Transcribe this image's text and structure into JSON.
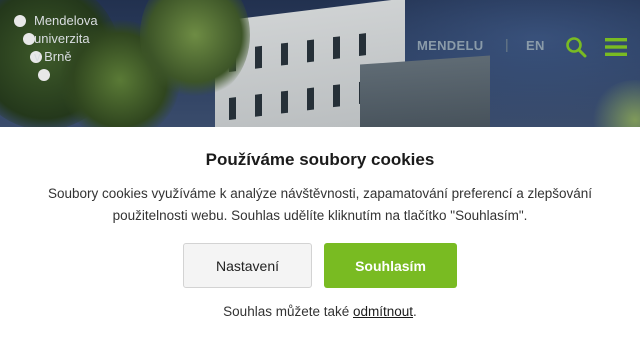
{
  "header": {
    "logo_lines": [
      "Mendelova",
      "univerzita",
      "v Brně"
    ],
    "nav_mendelu": "MENDELU",
    "nav_separator": "|",
    "nav_lang": "EN",
    "icons": {
      "search": "search-icon",
      "menu": "hamburger-menu-icon"
    },
    "accent_color": "#79bb22"
  },
  "cookie_banner": {
    "title": "Používáme soubory cookies",
    "message": "Soubory cookies využíváme k analýze návštěvnosti, zapamatování preferencí a zlepšování použitelnosti webu. Souhlas udělíte kliknutím na tlačítko \"Souhlasím\".",
    "settings_label": "Nastavení",
    "accept_label": "Souhlasím",
    "footnote_prefix": "Souhlas můžete také ",
    "reject_link": "odmítnout",
    "footnote_suffix": "."
  }
}
